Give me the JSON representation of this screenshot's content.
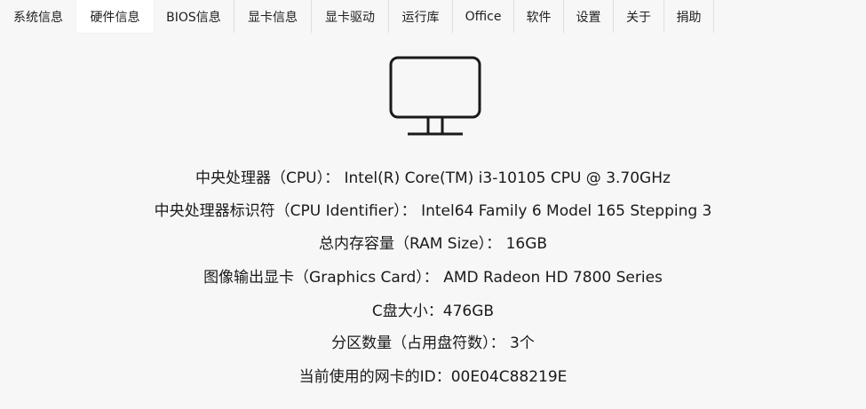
{
  "tabs": [
    {
      "label": "系统信息",
      "active": false
    },
    {
      "label": "硬件信息",
      "active": true
    },
    {
      "label": "BIOS信息",
      "active": false
    },
    {
      "label": "显卡信息",
      "active": false
    },
    {
      "label": "显卡驱动",
      "active": false
    },
    {
      "label": "运行库",
      "active": false
    },
    {
      "label": "Office",
      "active": false
    },
    {
      "label": "软件",
      "active": false
    },
    {
      "label": "设置",
      "active": false
    },
    {
      "label": "关于",
      "active": false
    },
    {
      "label": "捐助",
      "active": false
    }
  ],
  "hardware": {
    "icon": "monitor-icon",
    "lines": [
      "中央处理器（CPU）： Intel(R) Core(TM) i3-10105 CPU @ 3.70GHz",
      "中央处理器标识符（CPU Identifier）： Intel64 Family 6 Model 165 Stepping 3",
      "总内存容量（RAM Size）： 16GB",
      "图像输出显卡（Graphics Card）： AMD Radeon HD 7800 Series",
      "C盘大小：476GB",
      "分区数量（占用盘符数）： 3个",
      "当前使用的网卡的ID：00E04C88219E"
    ]
  }
}
